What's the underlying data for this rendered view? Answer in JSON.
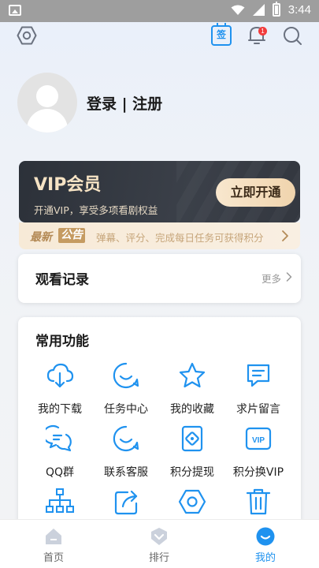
{
  "status_bar": {
    "time": "3:44"
  },
  "header": {
    "sign_in_label": "签",
    "notification_count": "1"
  },
  "profile": {
    "login_text": "登录 | 注册"
  },
  "vip": {
    "title": "VIP会员",
    "subtitle": "开通VIP，享受多项看剧权益",
    "button_label": "立即开通"
  },
  "notice": {
    "label_new": "最新",
    "label_notice": "公告",
    "text": "弹幕、评分、完成每日任务可获得积分"
  },
  "history": {
    "title": "观看记录",
    "more_label": "更多"
  },
  "features": {
    "title": "常用功能",
    "items": [
      {
        "label": "我的下载",
        "icon": "cloud-download-icon"
      },
      {
        "label": "任务中心",
        "icon": "smile-icon"
      },
      {
        "label": "我的收藏",
        "icon": "star-icon"
      },
      {
        "label": "求片留言",
        "icon": "message-icon"
      },
      {
        "label": "QQ群",
        "icon": "chat-bubbles-icon"
      },
      {
        "label": "联系客服",
        "icon": "customer-service-icon"
      },
      {
        "label": "积分提现",
        "icon": "wallet-icon"
      },
      {
        "label": "积分换VIP",
        "icon": "vip-icon"
      },
      {
        "label": "",
        "icon": "sitemap-icon"
      },
      {
        "label": "",
        "icon": "share-icon"
      },
      {
        "label": "",
        "icon": "settings-icon"
      },
      {
        "label": "",
        "icon": "trash-icon"
      }
    ]
  },
  "bottom_nav": [
    {
      "label": "首页",
      "icon": "home-icon"
    },
    {
      "label": "排行",
      "icon": "rank-icon"
    },
    {
      "label": "我的",
      "icon": "profile-icon"
    }
  ],
  "colors": {
    "accent": "#1f92ef",
    "vip_gold": "#f6e3c4",
    "notice_gold": "#c59b62"
  }
}
